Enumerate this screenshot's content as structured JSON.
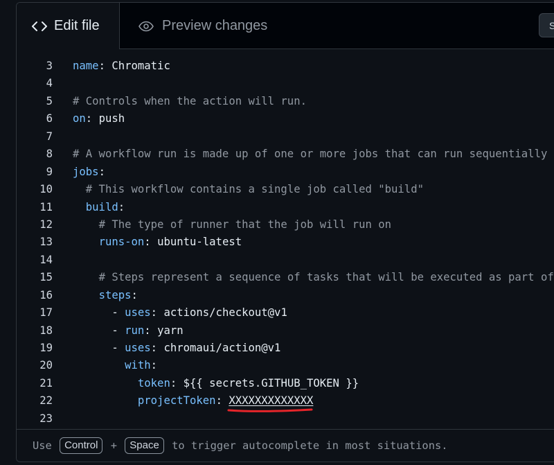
{
  "tabs": {
    "edit_label": "Edit file",
    "preview_label": "Preview changes",
    "settings_label": "S"
  },
  "code_lines": [
    {
      "num": "3",
      "indent": "",
      "key": "name",
      "sep": ": ",
      "value": "Chromatic",
      "comment": ""
    },
    {
      "num": "4",
      "indent": "",
      "key": "",
      "sep": "",
      "value": "",
      "comment": ""
    },
    {
      "num": "5",
      "indent": "",
      "key": "",
      "sep": "",
      "value": "",
      "comment": "# Controls when the action will run."
    },
    {
      "num": "6",
      "indent": "",
      "key": "on",
      "sep": ": ",
      "value": "push",
      "comment": ""
    },
    {
      "num": "7",
      "indent": "",
      "key": "",
      "sep": "",
      "value": "",
      "comment": ""
    },
    {
      "num": "8",
      "indent": "",
      "key": "",
      "sep": "",
      "value": "",
      "comment": "# A workflow run is made up of one or more jobs that can run sequentially or in parallel"
    },
    {
      "num": "9",
      "indent": "",
      "key": "jobs",
      "sep": ":",
      "value": "",
      "comment": ""
    },
    {
      "num": "10",
      "indent": "  ",
      "key": "",
      "sep": "",
      "value": "",
      "comment": "# This workflow contains a single job called \"build\""
    },
    {
      "num": "11",
      "indent": "  ",
      "key": "build",
      "sep": ":",
      "value": "",
      "comment": ""
    },
    {
      "num": "12",
      "indent": "    ",
      "key": "",
      "sep": "",
      "value": "",
      "comment": "# The type of runner that the job will run on"
    },
    {
      "num": "13",
      "indent": "    ",
      "key": "runs-on",
      "sep": ": ",
      "value": "ubuntu-latest",
      "comment": ""
    },
    {
      "num": "14",
      "indent": "",
      "key": "",
      "sep": "",
      "value": "",
      "comment": ""
    },
    {
      "num": "15",
      "indent": "    ",
      "key": "",
      "sep": "",
      "value": "",
      "comment": "# Steps represent a sequence of tasks that will be executed as part of the job"
    },
    {
      "num": "16",
      "indent": "    ",
      "key": "steps",
      "sep": ":",
      "value": "",
      "comment": ""
    },
    {
      "num": "17",
      "indent": "      - ",
      "key": "uses",
      "sep": ": ",
      "value": "actions/checkout@v1",
      "comment": ""
    },
    {
      "num": "18",
      "indent": "      - ",
      "key": "run",
      "sep": ": ",
      "value": "yarn",
      "comment": ""
    },
    {
      "num": "19",
      "indent": "      - ",
      "key": "uses",
      "sep": ": ",
      "value": "chromaui/action@v1",
      "comment": ""
    },
    {
      "num": "20",
      "indent": "        ",
      "key": "with",
      "sep": ":",
      "value": "",
      "comment": ""
    },
    {
      "num": "21",
      "indent": "          ",
      "key": "token",
      "sep": ": ",
      "value": "${{ secrets.GITHUB_TOKEN }}",
      "comment": ""
    },
    {
      "num": "22",
      "indent": "          ",
      "key": "projectToken",
      "sep": ": ",
      "value": "XXXXXXXXXXXXX",
      "comment": "",
      "redacted": true
    },
    {
      "num": "23",
      "indent": "",
      "key": "",
      "sep": "",
      "value": "",
      "comment": ""
    }
  ],
  "footer": {
    "prefix": "Use ",
    "key1": "Control",
    "plus": " + ",
    "key2": "Space",
    "suffix": " to trigger autocomplete in most situations."
  },
  "colors": {
    "key": "#79c0ff",
    "comment": "#9198a1",
    "annotation_underline": "#e5252a"
  },
  "icons": {
    "edit_tab": "code-icon",
    "preview_tab": "eye-icon"
  }
}
